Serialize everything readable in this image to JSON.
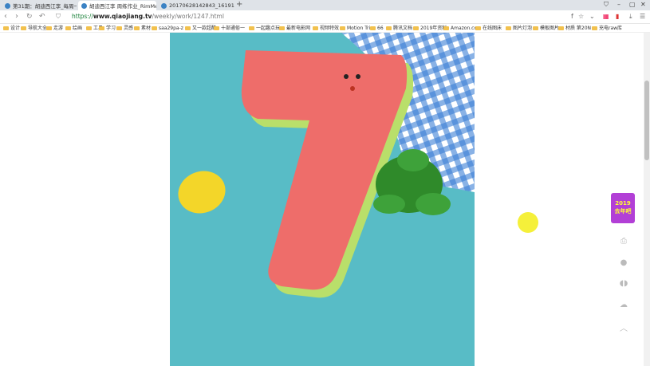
{
  "tabs": [
    {
      "label": "第31期：胡迪西江李_每周一织..."
    },
    {
      "label": "胡迪西江李 周练作业_RimMel"
    },
    {
      "label": "20170628142843_16191.jpg"
    }
  ],
  "address": {
    "proto": "https://",
    "host": "www.qiaojiang.tv",
    "path": "/weekly/work/1247.html"
  },
  "bookmarks": [
    "设计",
    "导航大全",
    "走游",
    "绘画",
    "工具",
    "学习",
    "灵感",
    "素材",
    "saa29pa-z",
    "又一款超酷",
    "十部通俗一",
    "一起趣点玩",
    "最新电影网",
    "视频特效",
    "Motion Tri",
    "66",
    "腾讯文档",
    "2019年资料",
    "Amazon.co",
    "在线图床",
    "图片灯泡",
    "模板图片",
    "材质 第20N",
    "充电raw库"
  ],
  "sidebar": {
    "badge_line1": "2019",
    "badge_line2": "去年吧"
  }
}
